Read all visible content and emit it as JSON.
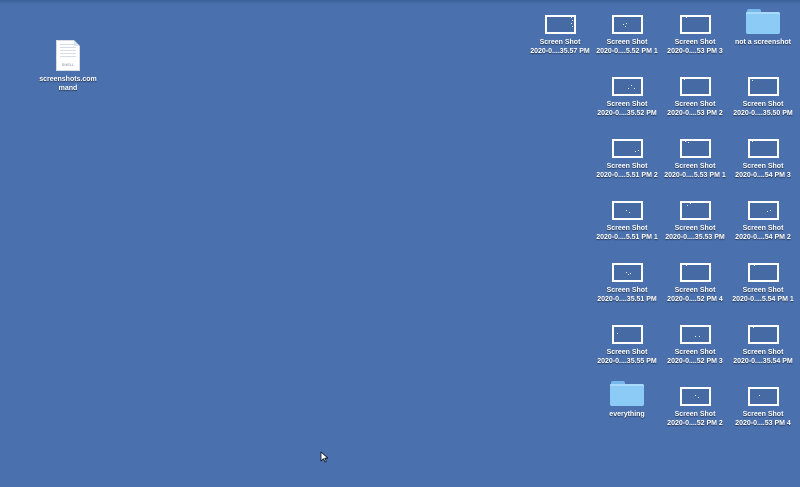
{
  "desktop": {
    "background_color": "#4a70ad",
    "left_file": {
      "name_line1": "screenshots.com",
      "name_line2": "mand",
      "type_label": "SHELL",
      "icon": "document-icon"
    },
    "items": [
      {
        "kind": "screenshot",
        "line1": "Screen Shot",
        "line2": "2020-0....35.57 PM"
      },
      {
        "kind": "screenshot",
        "line1": "Screen Shot",
        "line2": "2020-0....5.52 PM 1"
      },
      {
        "kind": "screenshot",
        "line1": "Screen Shot",
        "line2": "2020-0....53 PM 3"
      },
      {
        "kind": "folder",
        "line1": "not a screenshot",
        "line2": ""
      },
      {
        "kind": "screenshot",
        "line1": "Screen Shot",
        "line2": "2020-0....35.52 PM"
      },
      {
        "kind": "screenshot",
        "line1": "Screen Shot",
        "line2": "2020-0....53 PM 2"
      },
      {
        "kind": "screenshot",
        "line1": "Screen Shot",
        "line2": "2020-0....35.50 PM"
      },
      {
        "kind": "screenshot",
        "line1": "Screen Shot",
        "line2": "2020-0....5.51 PM 2"
      },
      {
        "kind": "screenshot",
        "line1": "Screen Shot",
        "line2": "2020-0....5.53 PM 1"
      },
      {
        "kind": "screenshot",
        "line1": "Screen Shot",
        "line2": "2020-0....54 PM 3"
      },
      {
        "kind": "screenshot",
        "line1": "Screen Shot",
        "line2": "2020-0....5.51 PM 1"
      },
      {
        "kind": "screenshot",
        "line1": "Screen Shot",
        "line2": "2020-0....35.53 PM"
      },
      {
        "kind": "screenshot",
        "line1": "Screen Shot",
        "line2": "2020-0....54 PM 2"
      },
      {
        "kind": "screenshot",
        "line1": "Screen Shot",
        "line2": "2020-0....35.51 PM"
      },
      {
        "kind": "screenshot",
        "line1": "Screen Shot",
        "line2": "2020-0....52 PM 4"
      },
      {
        "kind": "screenshot",
        "line1": "Screen Shot",
        "line2": "2020-0....5.54 PM 1"
      },
      {
        "kind": "screenshot",
        "line1": "Screen Shot",
        "line2": "2020-0....35.55 PM"
      },
      {
        "kind": "screenshot",
        "line1": "Screen Shot",
        "line2": "2020-0....52 PM 3"
      },
      {
        "kind": "screenshot",
        "line1": "Screen Shot",
        "line2": "2020-0....35.54 PM"
      },
      {
        "kind": "folder",
        "line1": "everything",
        "line2": ""
      },
      {
        "kind": "screenshot",
        "line1": "Screen Shot",
        "line2": "2020-0....52 PM 2"
      },
      {
        "kind": "screenshot",
        "line1": "Screen Shot",
        "line2": "2020-0....53 PM 4"
      }
    ]
  }
}
